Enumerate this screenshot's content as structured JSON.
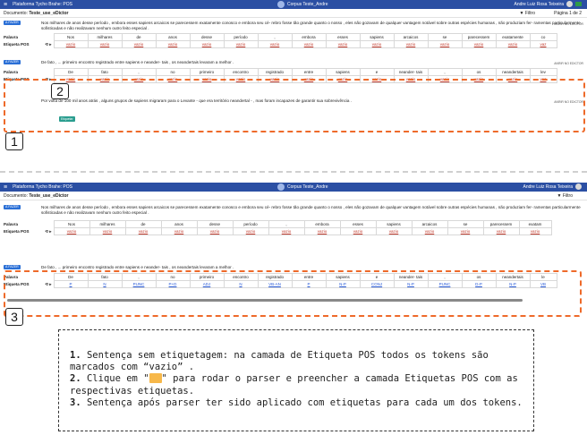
{
  "app": {
    "title": "Plataforma Tycho Brahe: POS",
    "corpus": "Corpus Teste_Andre",
    "user": "Andre Luiz Rosa Teixeira",
    "user_short": "Andre Luiz Rosa Teixeira",
    "menu_glyph": "≡"
  },
  "doc": {
    "label": "Documento:",
    "name": "Teste_use_eDictor",
    "filter": "▼ Filtro",
    "page": "Página 1 de 2"
  },
  "rows": {
    "palavra": "Palavra",
    "etiqueta": "Etiqueta POS",
    "controls": "⟲ ▸"
  },
  "tag_label": "A FAZER",
  "send_label": "ANRIR NO EDICTOR",
  "s1": {
    "text": "Nos milhares de anos desse período , embora esses sapiens arcaicos se parecessem exatamente conosco e embora seu cé- rebro fosse tão grande quanto o nosso , eles não gozavam de qualquer vantagem notável sobre outras espécies humanas , não produziam fer- ramentas particularmente sofisticadas e não realizavam nenhum outro feito especial .",
    "words": [
      "Nos",
      "milhares",
      "de",
      "anos",
      "desse",
      "período",
      ",",
      "embora",
      "esses",
      "sapiens",
      "arcaicos",
      "se",
      "parecessem",
      "exatamente",
      "co"
    ],
    "tags": [
      "vazio",
      "vazio",
      "vazio",
      "vazio",
      "vazio",
      "vazio",
      "vazio",
      "vazio",
      "vazio",
      "vazio",
      "vazio",
      "vazio",
      "vazio",
      "vazio",
      "vaz"
    ]
  },
  "s2": {
    "text": "De fato , ... primeiro encontro registrado entre sapiens e neander- tais , os neandertais levaram a melhor .",
    "words": [
      "De",
      "fato",
      ",",
      "no",
      "primeiro",
      "encontro",
      "registrado",
      "entre",
      "sapiens",
      "e",
      "neander- tais",
      ",",
      "os",
      "neandertais",
      "lev"
    ],
    "tags": [
      "vazio",
      "vazio",
      "vazio",
      "vazio",
      "vazio",
      "vazio",
      "vazio",
      "vazio",
      "vazio",
      "vazio",
      "vazio",
      "vazio",
      "vazio",
      "vazio",
      "vaz"
    ],
    "tooltip": "Etiquetar"
  },
  "s3": {
    "text": "Por volta de 100 mil anos atrás , alguns grupos de sapiens migraram para o Levante - que era território neandertal - , mas foram incapazes de garantir sua sobrevivência ."
  },
  "s1b": {
    "words": [
      "Nos",
      "milhares",
      "de",
      "anos",
      "desse",
      "período",
      ",",
      "embora",
      "esses",
      "sapiens",
      "arcaicos",
      "se",
      "parecessem",
      "exatam"
    ],
    "tags": [
      "vazio",
      "vazio",
      "vazio",
      "vazio",
      "vazio",
      "vazio",
      "vazio",
      "vazio",
      "vazio",
      "vazio",
      "vazio",
      "vazio",
      "vazio",
      "vazio"
    ]
  },
  "s2b": {
    "text": "De fato , ... primeiro encontro registrado entre sapiens e neander- tais , os neandertais levaram a melhor .",
    "words": [
      "De",
      "fato",
      ",",
      "no",
      "primeiro",
      "encontro",
      "registrado",
      "entre",
      "sapiens",
      "e",
      "neander- tais",
      ",",
      "os",
      "neandertais",
      "le"
    ],
    "tags": [
      "P",
      "N",
      "PUNC",
      "P+D",
      "ADJ",
      "N",
      "VB-AN",
      "P",
      "N-P",
      "CONJ",
      "N-P",
      "PUNC",
      "D-P",
      "N-P",
      "VB"
    ]
  },
  "markers": [
    "1",
    "2",
    "3"
  ],
  "note": {
    "n1": "1.",
    "l1": " Sentença sem etiquetagem: na camada de Etiqueta POS todos os tokens são marcados com “vazio” .",
    "n2": "2.",
    "l2a": " Clique em \"",
    "l2b": "\" para rodar o parser e preencher a camada Etiquetas POS com as respectivas etiquetas.",
    "n3": "3.",
    "l3": " Sentença após parser ter sido aplicado com etiquetas para cada um dos tokens."
  },
  "colors": {
    "appbar": "#2b4fa3",
    "accent": "#ee6a2a",
    "tag": "#2a6fd6",
    "empty": "#c0392b",
    "filled": "#2a5bd7"
  }
}
